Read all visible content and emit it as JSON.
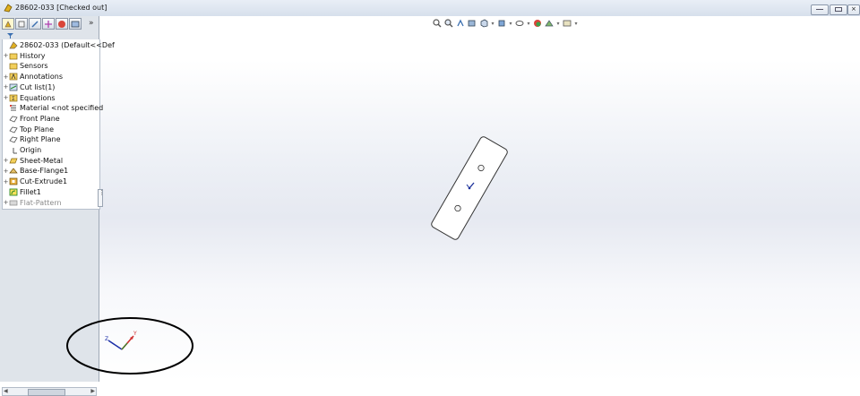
{
  "window": {
    "title": "28602-033 [Checked out]"
  },
  "panel": {
    "more_label": "»",
    "tree": [
      {
        "label": "28602-033  (Default<<Def",
        "icon": "part-icon",
        "expand": ""
      },
      {
        "label": "History",
        "icon": "history-folder-icon",
        "expand": "+"
      },
      {
        "label": "Sensors",
        "icon": "sensors-folder-icon",
        "expand": ""
      },
      {
        "label": "Annotations",
        "icon": "annotations-icon",
        "expand": "+"
      },
      {
        "label": "Cut list(1)",
        "icon": "cut-list-icon",
        "expand": "+"
      },
      {
        "label": "Equations",
        "icon": "equations-icon",
        "expand": "+"
      },
      {
        "label": "Material <not specified",
        "icon": "material-icon",
        "expand": ""
      },
      {
        "label": "Front Plane",
        "icon": "plane-icon",
        "expand": ""
      },
      {
        "label": "Top Plane",
        "icon": "plane-icon",
        "expand": ""
      },
      {
        "label": "Right Plane",
        "icon": "plane-icon",
        "expand": ""
      },
      {
        "label": "Origin",
        "icon": "origin-icon",
        "expand": ""
      },
      {
        "label": "Sheet-Metal",
        "icon": "sheet-metal-icon",
        "expand": "+"
      },
      {
        "label": "Base-Flange1",
        "icon": "base-flange-icon",
        "expand": "+"
      },
      {
        "label": "Cut-Extrude1",
        "icon": "cut-extrude-icon",
        "expand": "+"
      },
      {
        "label": "Fillet1",
        "icon": "fillet-icon",
        "expand": ""
      },
      {
        "label": "Flat-Pattern",
        "icon": "flat-pattern-icon",
        "expand": "+",
        "suppressed": true
      }
    ]
  },
  "triad": {
    "z_label": "Z",
    "y_label": "Y"
  }
}
